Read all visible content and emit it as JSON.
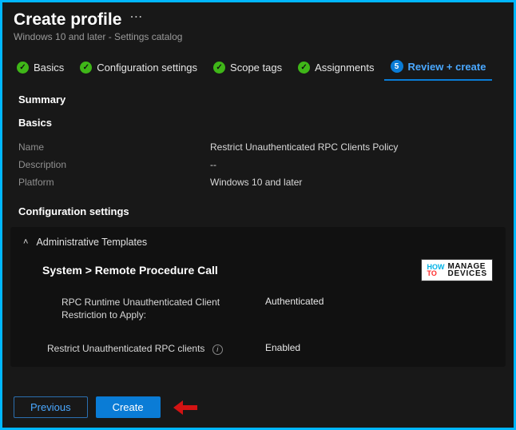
{
  "header": {
    "title": "Create profile",
    "subtitle": "Windows 10 and later - Settings catalog"
  },
  "steps": [
    {
      "label": "Basics",
      "state": "done"
    },
    {
      "label": "Configuration settings",
      "state": "done"
    },
    {
      "label": "Scope tags",
      "state": "done"
    },
    {
      "label": "Assignments",
      "state": "done"
    },
    {
      "num": "5",
      "label": "Review + create",
      "state": "active"
    }
  ],
  "summary_heading": "Summary",
  "basics": {
    "heading": "Basics",
    "rows": {
      "name_label": "Name",
      "name_value": "Restrict Unauthenticated RPC Clients Policy",
      "desc_label": "Description",
      "desc_value": "--",
      "platform_label": "Platform",
      "platform_value": "Windows 10 and later"
    }
  },
  "config": {
    "heading": "Configuration settings",
    "group": "Administrative Templates",
    "path": "System > Remote Procedure Call",
    "settings": [
      {
        "label": "RPC Runtime Unauthenticated Client Restriction to Apply:",
        "value": "Authenticated",
        "info": false
      },
      {
        "label": "Restrict Unauthenticated RPC clients",
        "value": "Enabled",
        "info": true
      }
    ]
  },
  "watermark": {
    "how": "HOW",
    "to": "TO",
    "manage": "MANAGE",
    "devices": "DEVICES"
  },
  "footer": {
    "previous": "Previous",
    "create": "Create"
  }
}
